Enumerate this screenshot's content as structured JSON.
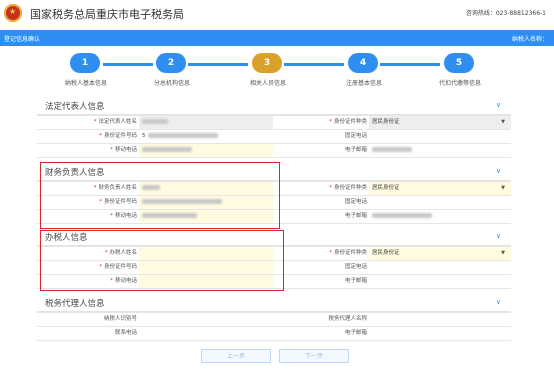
{
  "header": {
    "site_title": "国家税务总局重庆市电子税务局",
    "hotline": "咨询热线：023-88812366-1"
  },
  "bluebar": {
    "left_label": "登记信息确认",
    "right_label": "纳税人名称："
  },
  "steps": [
    {
      "num": "1",
      "label": "纳税人基本信息",
      "state": "done"
    },
    {
      "num": "2",
      "label": "分总机构信息",
      "state": "done"
    },
    {
      "num": "3",
      "label": "相关人员信息",
      "state": "current"
    },
    {
      "num": "4",
      "label": "注册基本信息",
      "state": "todo"
    },
    {
      "num": "5",
      "label": "代扣代缴等信息",
      "state": "todo"
    }
  ],
  "colors": {
    "step_blue": "#2f8ff0",
    "step_current": "#d9a02a",
    "accent_red": "#d8262c"
  },
  "sections": {
    "legal": {
      "title": "法定代表人信息",
      "name_label": "法定代表人姓名",
      "idno_label": "身份证件号码",
      "mobile_label": "移动电话",
      "idtype_label": "身份证件种类",
      "idtype_value": "居民身份证",
      "phone_label": "固定电话",
      "email_label": "电子邮箱",
      "idno_prefix": "5"
    },
    "finance": {
      "title": "财务负责人信息",
      "name_label": "财务负责人姓名",
      "idno_label": "身份证件号码",
      "mobile_label": "移动电话",
      "idtype_label": "身份证件种类",
      "idtype_value": "居民身份证",
      "phone_label": "固定电话",
      "email_label": "电子邮箱"
    },
    "taxer": {
      "title": "办税人信息",
      "name_label": "办税人姓名",
      "idno_label": "身份证件号码",
      "mobile_label": "移动电话",
      "idtype_label": "身份证件种类",
      "idtype_value": "居民身份证",
      "phone_label": "固定电话",
      "email_label": "电子邮箱"
    },
    "agent": {
      "title": "税务代理人信息",
      "taxid_label": "纳税人识别号",
      "contact_label": "联系电话",
      "agent_name_label": "税务代理人名称",
      "email_label": "电子邮箱"
    }
  },
  "buttons": {
    "prev": "上一步",
    "next": "下一步"
  }
}
